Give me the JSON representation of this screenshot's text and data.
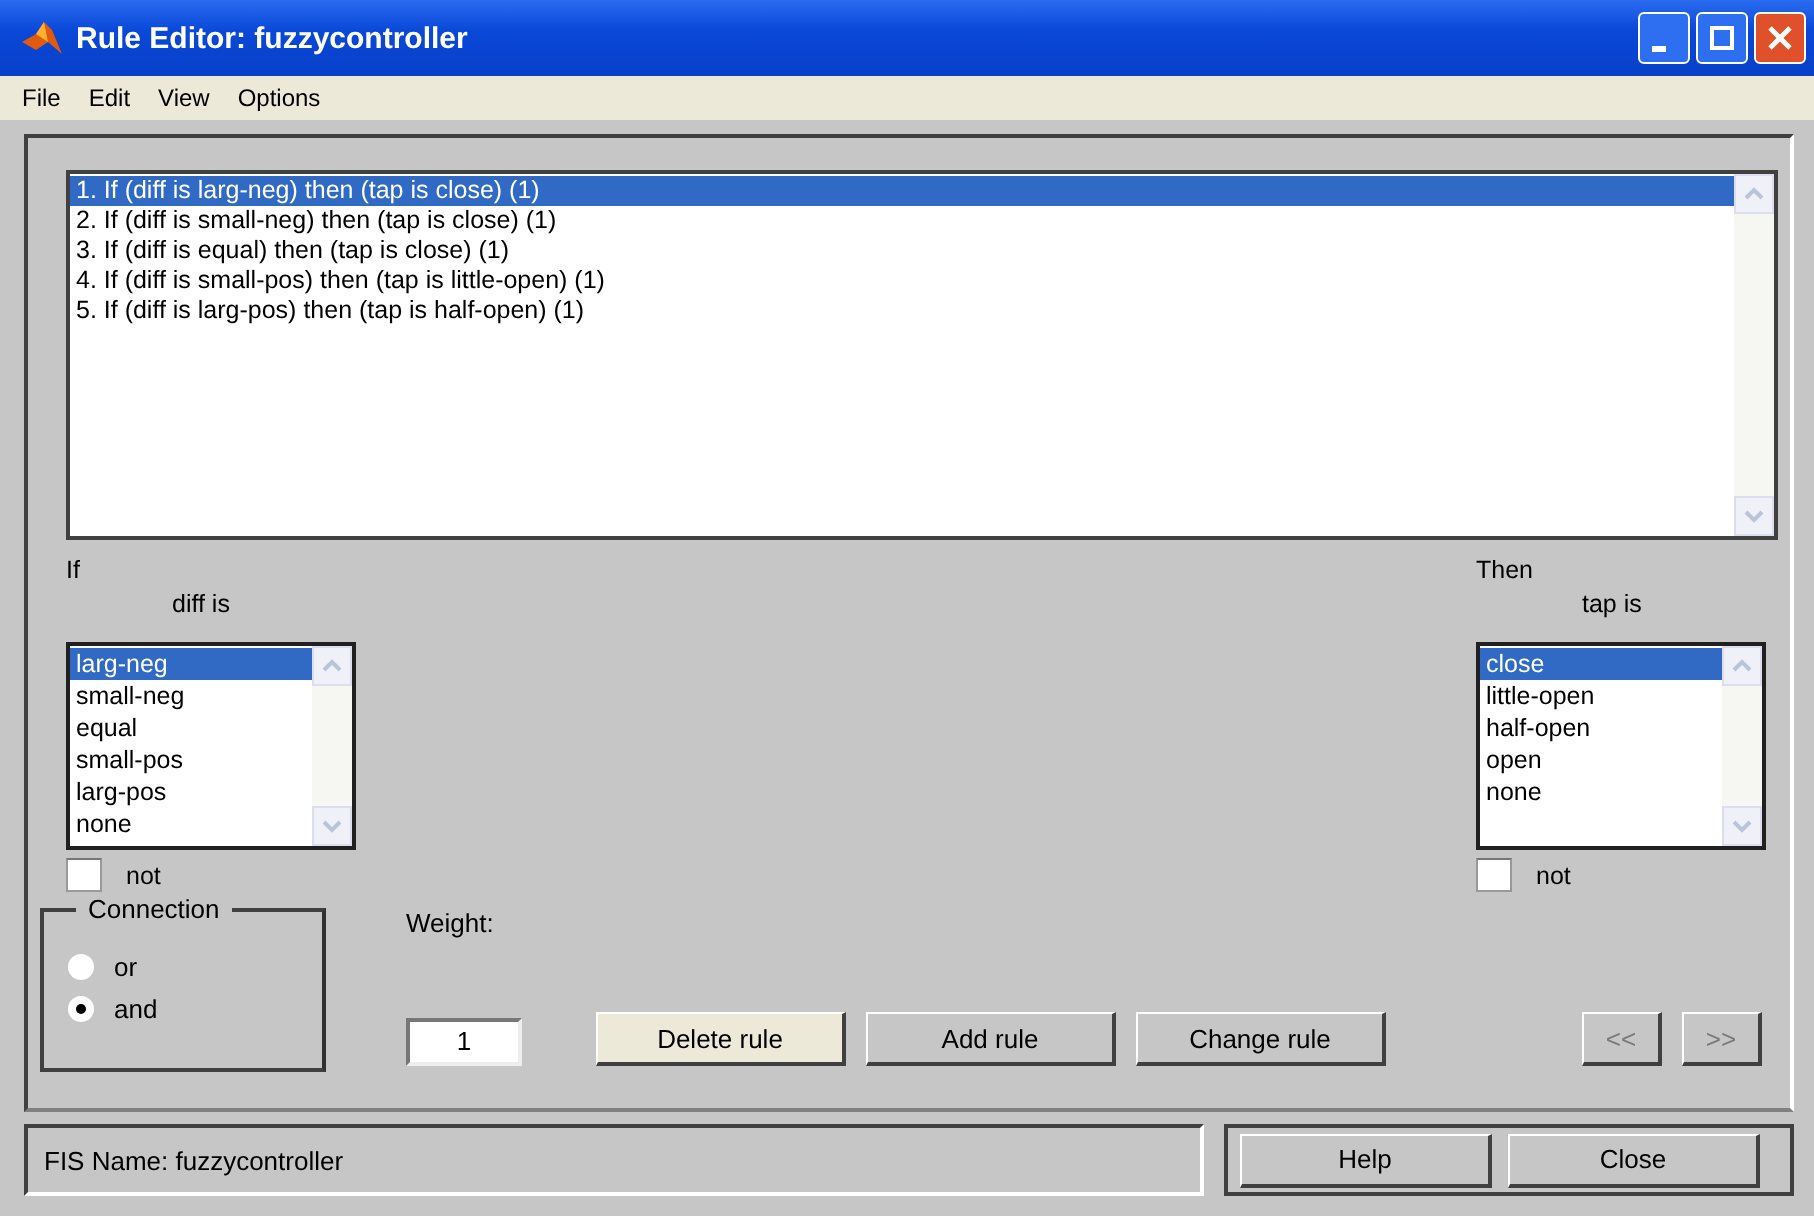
{
  "window": {
    "title": "Rule Editor: fuzzycontroller"
  },
  "menu": [
    "File",
    "Edit",
    "View",
    "Options"
  ],
  "rules": [
    {
      "text": "1. If (diff is larg-neg) then (tap is close) (1)",
      "selected": true
    },
    {
      "text": "2. If (diff is small-neg) then (tap is close) (1)",
      "selected": false
    },
    {
      "text": "3. If (diff is equal) then (tap is close) (1)",
      "selected": false
    },
    {
      "text": "4. If (diff is small-pos) then (tap is little-open) (1)",
      "selected": false
    },
    {
      "text": "5. If (diff is larg-pos) then (tap is half-open) (1)",
      "selected": false
    }
  ],
  "if_panel": {
    "title": "If",
    "variable": "diff is",
    "not_label": "not",
    "not_checked": false,
    "items": [
      {
        "label": "larg-neg",
        "selected": true
      },
      {
        "label": "small-neg",
        "selected": false
      },
      {
        "label": "equal",
        "selected": false
      },
      {
        "label": "small-pos",
        "selected": false
      },
      {
        "label": "larg-pos",
        "selected": false
      },
      {
        "label": "none",
        "selected": false
      }
    ]
  },
  "then_panel": {
    "title": "Then",
    "variable": "tap is",
    "not_label": "not",
    "not_checked": false,
    "items": [
      {
        "label": "close",
        "selected": true
      },
      {
        "label": "little-open",
        "selected": false
      },
      {
        "label": "half-open",
        "selected": false
      },
      {
        "label": "open",
        "selected": false
      },
      {
        "label": "none",
        "selected": false
      }
    ]
  },
  "connection": {
    "title": "Connection",
    "options": [
      {
        "label": "or",
        "selected": false
      },
      {
        "label": "and",
        "selected": true
      }
    ]
  },
  "weight": {
    "label": "Weight:",
    "value": "1"
  },
  "rule_buttons": [
    {
      "label": "Delete rule",
      "focused": true
    },
    {
      "label": "Add rule",
      "focused": false
    },
    {
      "label": "Change rule",
      "focused": false
    }
  ],
  "nav_buttons": [
    {
      "label": "<<",
      "disabled": true
    },
    {
      "label": ">>",
      "disabled": true
    }
  ],
  "status_bar": {
    "text": "FIS Name: fuzzycontroller"
  },
  "footer_buttons": [
    "Help",
    "Close"
  ]
}
